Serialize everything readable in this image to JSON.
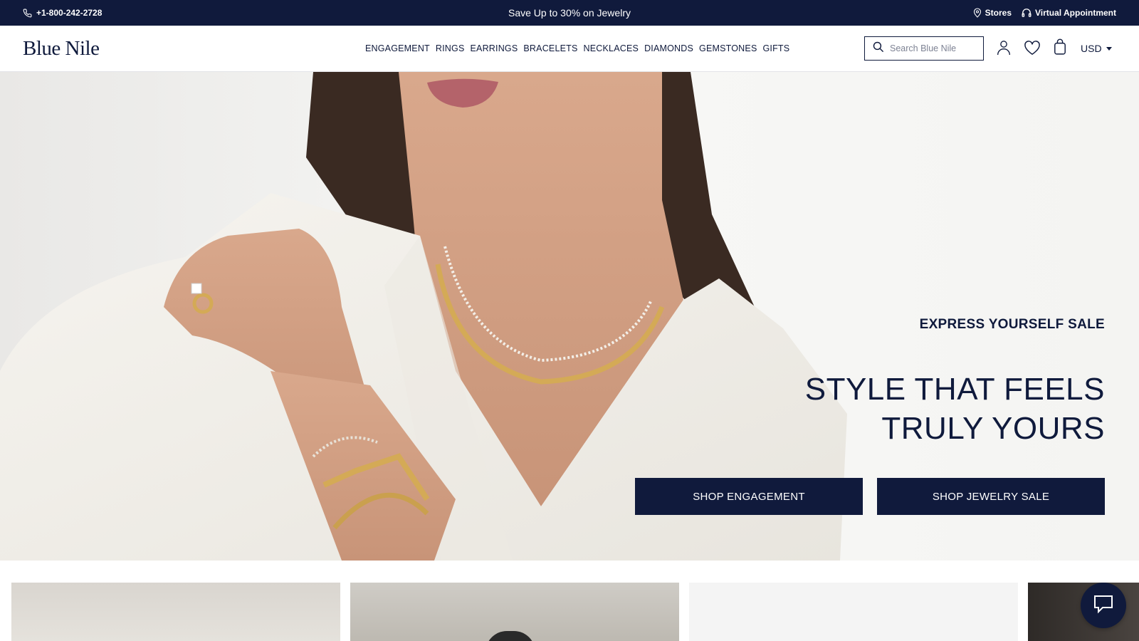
{
  "topbar": {
    "phone": "+1-800-242-2728",
    "promo": "Save Up to 30% on Jewelry",
    "stores": "Stores",
    "appointment": "Virtual Appointment"
  },
  "header": {
    "logo": "Blue Nile",
    "nav": [
      "ENGAGEMENT",
      "RINGS",
      "EARRINGS",
      "BRACELETS",
      "NECKLACES",
      "DIAMONDS",
      "GEMSTONES",
      "GIFTS"
    ],
    "search_placeholder": "Search Blue Nile",
    "currency": "USD"
  },
  "hero": {
    "eyebrow": "EXPRESS YOURSELF SALE",
    "headline_line1": "STYLE THAT FEELS",
    "headline_line2": "TRULY YOURS",
    "button_engagement": "SHOP ENGAGEMENT",
    "button_sale": "SHOP JEWELRY SALE"
  },
  "icons": {
    "phone": "phone-icon",
    "stores": "map-pin-icon",
    "appointment": "headset-icon",
    "search": "search-icon",
    "account": "user-icon",
    "wishlist": "heart-icon",
    "bag": "shopping-bag-icon",
    "chat": "chat-icon"
  },
  "colors": {
    "brand_navy": "#101a3c",
    "text": "#0f1a3c",
    "white": "#ffffff"
  }
}
